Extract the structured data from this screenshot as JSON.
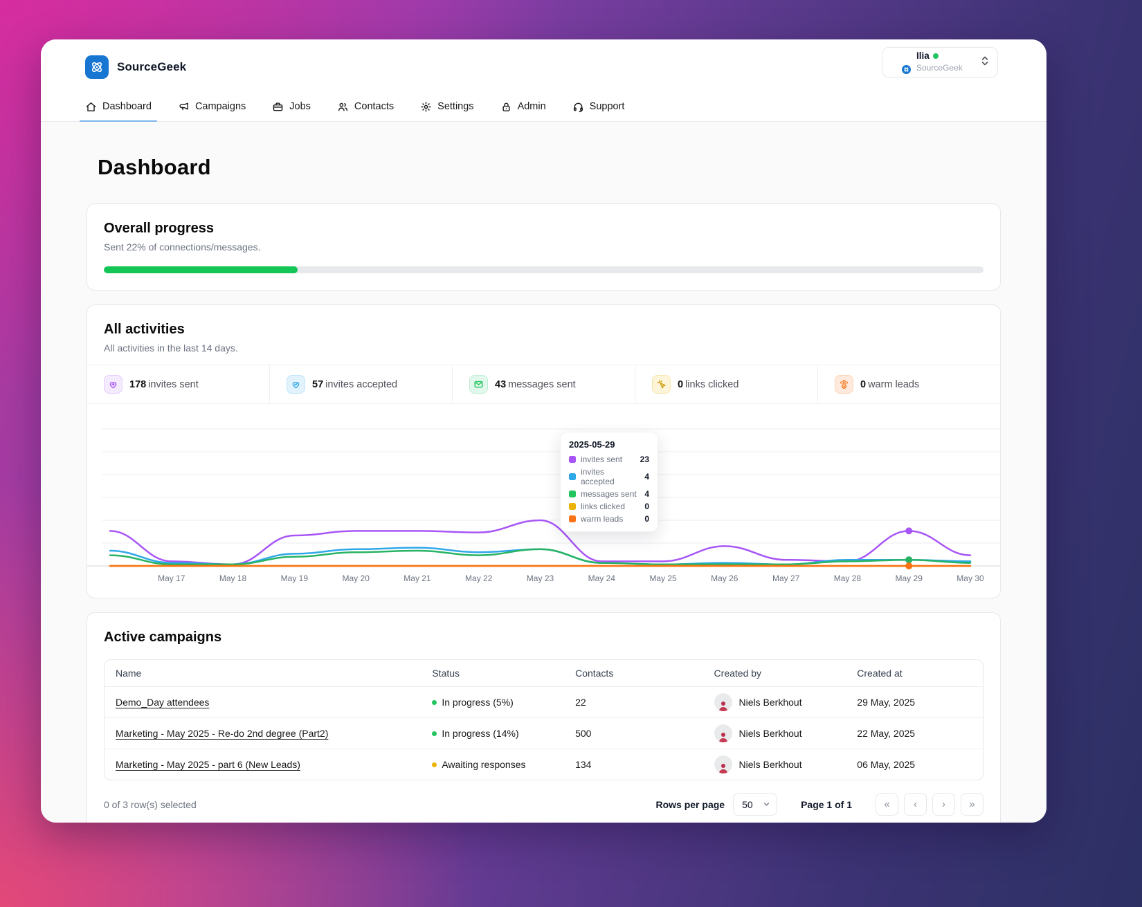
{
  "brand": {
    "name": "SourceGeek"
  },
  "user": {
    "name": "Ilia",
    "org": "SourceGeek",
    "status": "online"
  },
  "nav": {
    "items": [
      {
        "label": "Dashboard",
        "active": true
      },
      {
        "label": "Campaigns",
        "active": false
      },
      {
        "label": "Jobs",
        "active": false
      },
      {
        "label": "Contacts",
        "active": false
      },
      {
        "label": "Settings",
        "active": false
      },
      {
        "label": "Admin",
        "active": false
      },
      {
        "label": "Support",
        "active": false
      }
    ]
  },
  "page": {
    "title": "Dashboard"
  },
  "overall_progress": {
    "title": "Overall progress",
    "subtitle": "Sent 22% of connections/messages.",
    "percent": 22,
    "bar_color": "#13c656"
  },
  "activities": {
    "title": "All activities",
    "subtitle": "All activities in the last 14 days.",
    "stats": [
      {
        "value": "178",
        "label": "invites sent",
        "color": "#a855f7"
      },
      {
        "value": "57",
        "label": "invites accepted",
        "color": "#2fa8e8"
      },
      {
        "value": "43",
        "label": "messages sent",
        "color": "#22c55e"
      },
      {
        "value": "0",
        "label": "links clicked",
        "color": "#eab308"
      },
      {
        "value": "0",
        "label": "warm leads",
        "color": "#f97316"
      }
    ]
  },
  "chart_data": {
    "type": "line",
    "categories": [
      "",
      "May 17",
      "May 18",
      "May 19",
      "May 20",
      "May 21",
      "May 22",
      "May 23",
      "May 24",
      "May 25",
      "May 26",
      "May 27",
      "May 28",
      "May 29",
      "May 30"
    ],
    "series": [
      {
        "name": "invites sent",
        "color": "#a855f7",
        "values": [
          23,
          3,
          1,
          20,
          23,
          23,
          22,
          30,
          3,
          3,
          13,
          4,
          3,
          23,
          7
        ]
      },
      {
        "name": "invites accepted",
        "color": "#2fa8e8",
        "values": [
          10,
          2,
          1,
          8,
          11,
          12,
          9,
          11,
          2,
          1,
          2,
          1,
          4,
          4,
          3
        ]
      },
      {
        "name": "messages sent",
        "color": "#27b363",
        "values": [
          7,
          1,
          1,
          6,
          9,
          10,
          7,
          11,
          2,
          1,
          1,
          1,
          3,
          4,
          2
        ]
      },
      {
        "name": "links clicked",
        "color": "#eab308",
        "values": [
          0,
          0,
          0,
          0,
          0,
          0,
          0,
          0,
          0,
          0,
          0,
          0,
          0,
          0,
          0
        ]
      },
      {
        "name": "warm leads",
        "color": "#f97316",
        "values": [
          0,
          0,
          0,
          0,
          0,
          0,
          0,
          0,
          0,
          0,
          0,
          0,
          0,
          0,
          0
        ]
      }
    ],
    "hover_index": 13,
    "grid_step": 15,
    "gridlines": 6,
    "ylim": [
      0,
      90
    ],
    "legend_position": "tooltip",
    "title": "All activities",
    "xlabel": "",
    "ylabel": ""
  },
  "tooltip": {
    "date": "2025-05-29",
    "rows": [
      {
        "label": "invites sent",
        "value": "23",
        "color": "#a855f7"
      },
      {
        "label": "invites accepted",
        "value": "4",
        "color": "#2fa8e8"
      },
      {
        "label": "messages sent",
        "value": "4",
        "color": "#22c55e"
      },
      {
        "label": "links clicked",
        "value": "0",
        "color": "#eab308"
      },
      {
        "label": "warm leads",
        "value": "0",
        "color": "#f97316"
      }
    ]
  },
  "campaigns": {
    "title": "Active campaigns",
    "columns": [
      "Name",
      "Status",
      "Contacts",
      "Created by",
      "Created at"
    ],
    "rows": [
      {
        "name": "Demo_Day attendees",
        "status": "In progress (5%)",
        "status_color": "#22c55e",
        "contacts": "22",
        "created_by": "Niels Berkhout",
        "created_at": "29 May, 2025"
      },
      {
        "name": "Marketing - May 2025 - Re-do 2nd degree (Part2)",
        "status": "In progress (14%)",
        "status_color": "#22c55e",
        "contacts": "500",
        "created_by": "Niels Berkhout",
        "created_at": "22 May, 2025"
      },
      {
        "name": "Marketing - May 2025 - part 6 (New Leads)",
        "status": "Awaiting responses",
        "status_color": "#eab308",
        "contacts": "134",
        "created_by": "Niels Berkhout",
        "created_at": "06 May, 2025"
      }
    ],
    "footer": {
      "selected_text": "0 of 3 row(s) selected",
      "rows_per_page_label": "Rows per page",
      "rows_per_page_value": "50",
      "page_text": "Page 1 of 1",
      "pagination": {
        "first": "«",
        "prev": "‹",
        "next": "›",
        "last": "»"
      }
    }
  }
}
